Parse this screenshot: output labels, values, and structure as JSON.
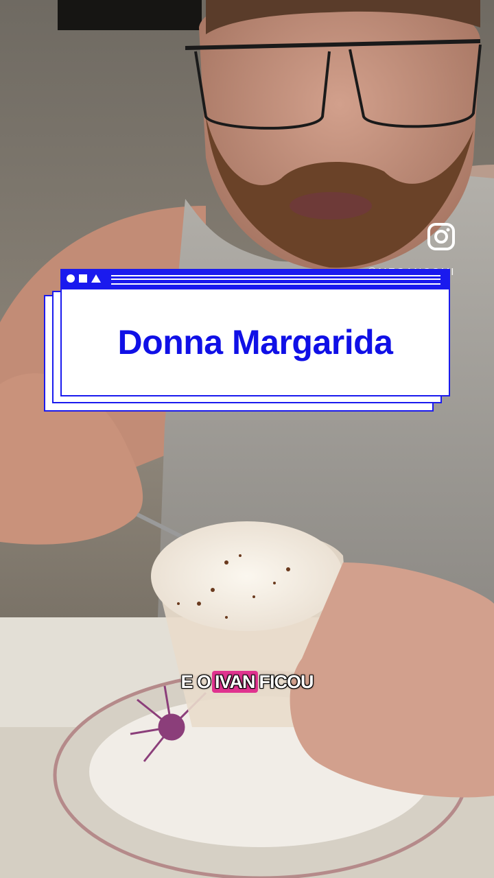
{
  "title_card": {
    "title": "Donna Margarida",
    "accent_color": "#1a1aee"
  },
  "social": {
    "icon": "instagram-icon",
    "handle": "@MEGANCOMIDAS"
  },
  "caption": {
    "before": "E O",
    "highlight": "IVAN",
    "after": "FICOU",
    "highlight_color": "#e0338f"
  }
}
